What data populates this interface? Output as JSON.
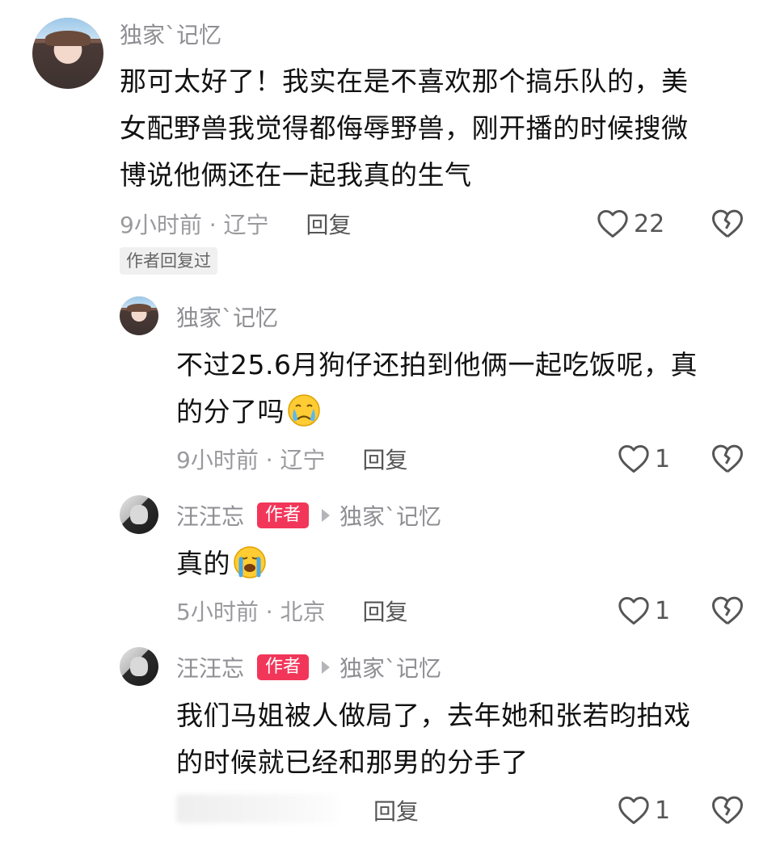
{
  "comments": [
    {
      "username": "独家`记忆",
      "text_lines": [
        "那可太好了！我实在是不喜欢那个搞乐队的，美",
        "女配野兽我觉得都侮辱野兽，刚开播的时候搜微",
        "博说他俩还在一起我真的生气"
      ],
      "time": "9小时前 · 辽宁",
      "reply_label": "回复",
      "likes": "22",
      "tag": "作者回复过",
      "avatar_icon": "woman-portrait-avatar"
    },
    {
      "username": "独家`记忆",
      "text_lines": [
        "不过25.6月狗仔还拍到他俩一起吃饭呢，真",
        "的分了吗"
      ],
      "time": "9小时前 · 辽宁",
      "reply_label": "回复",
      "likes": "1",
      "emoji": "crying-face-emoji",
      "avatar_icon": "woman-portrait-avatar"
    },
    {
      "username": "汪汪忘",
      "author_badge": "作者",
      "reply_to": "独家`记忆",
      "text": "真的",
      "time": "5小时前 · 北京",
      "reply_label": "回复",
      "likes": "1",
      "emoji": "loudly-crying-face-emoji",
      "avatar_icon": "man-portrait-avatar"
    },
    {
      "username": "汪汪忘",
      "author_badge": "作者",
      "reply_to": "独家`记忆",
      "text_lines": [
        "我们马姐被人做局了，去年她和张若昀拍戏",
        "的时候就已经和那男的分手了"
      ],
      "reply_label": "回复",
      "likes": "1",
      "avatar_icon": "man-portrait-avatar"
    }
  ],
  "colors": {
    "author_badge": "#f2365a",
    "secondary_text": "#8e8e93",
    "primary_text": "#111111"
  }
}
